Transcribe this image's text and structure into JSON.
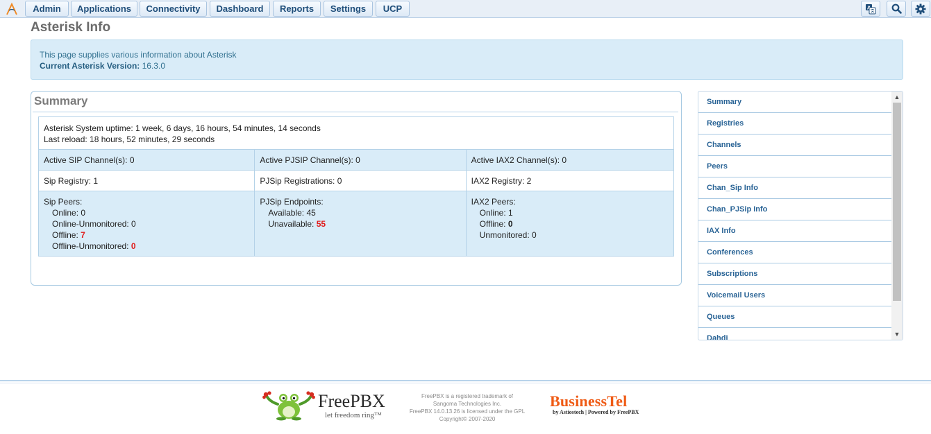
{
  "nav": {
    "items": [
      "Admin",
      "Applications",
      "Connectivity",
      "Dashboard",
      "Reports",
      "Settings",
      "UCP"
    ]
  },
  "page": {
    "title": "Asterisk Info",
    "info_text": "This page supplies various information about Asterisk",
    "version_label": "Current Asterisk Version:",
    "version_value": "16.3.0"
  },
  "summary": {
    "title": "Summary",
    "uptime": "Asterisk System uptime: 1 week, 6 days, 16 hours, 54 minutes, 14 seconds",
    "last_reload": "Last reload: 18 hours, 52 minutes, 29 seconds",
    "channels": [
      "Active SIP Channel(s): 0",
      "Active PJSIP Channel(s): 0",
      "Active IAX2 Channel(s): 0"
    ],
    "registries": [
      "Sip Registry: 1",
      "PJSip Registrations: 0",
      "IAX2 Registry: 2"
    ],
    "sip_peers": {
      "heading": "Sip Peers:",
      "online": "Online: 0",
      "online_unmonitored": "Online-Unmonitored: 0",
      "offline_label": "Offline:",
      "offline_value": "7",
      "offline_unmonitored_label": "Offline-Unmonitored:",
      "offline_unmonitored_value": "0"
    },
    "pjsip_endpoints": {
      "heading": "PJSip Endpoints:",
      "available": "Available: 45",
      "unavailable_label": "Unavailable:",
      "unavailable_value": "55"
    },
    "iax2_peers": {
      "heading": "IAX2 Peers:",
      "online": "Online: 1",
      "offline_label": "Offline:",
      "offline_value": "0",
      "unmonitored": "Unmonitored: 0"
    }
  },
  "sidebar": {
    "items": [
      "Summary",
      "Registries",
      "Channels",
      "Peers",
      "Chan_Sip Info",
      "Chan_PJSip Info",
      "IAX Info",
      "Conferences",
      "Subscriptions",
      "Voicemail Users",
      "Queues",
      "Dahdi"
    ]
  },
  "footer": {
    "freepbx_brand": "FreePBX",
    "freepbx_tagline": "let freedom ring™",
    "legal": [
      "FreePBX is a registered trademark of",
      "Sangoma Technologies Inc.",
      "FreePBX 14.0.13.26 is licensed under the GPL",
      "Copyright© 2007-2020"
    ],
    "business_brand": "BusinessTel",
    "business_tagline": "by Astiostech | Powered by FreePBX"
  },
  "colors": {
    "accent": "#1f4e7a",
    "info_bg": "#d9ecf8",
    "alert_red": "#e01b1b",
    "brand_orange": "#ef5a14"
  },
  "icons": [
    "freepbx-logo-icon",
    "translate-icon",
    "search-icon",
    "gear-icon",
    "frog-logo-icon"
  ]
}
